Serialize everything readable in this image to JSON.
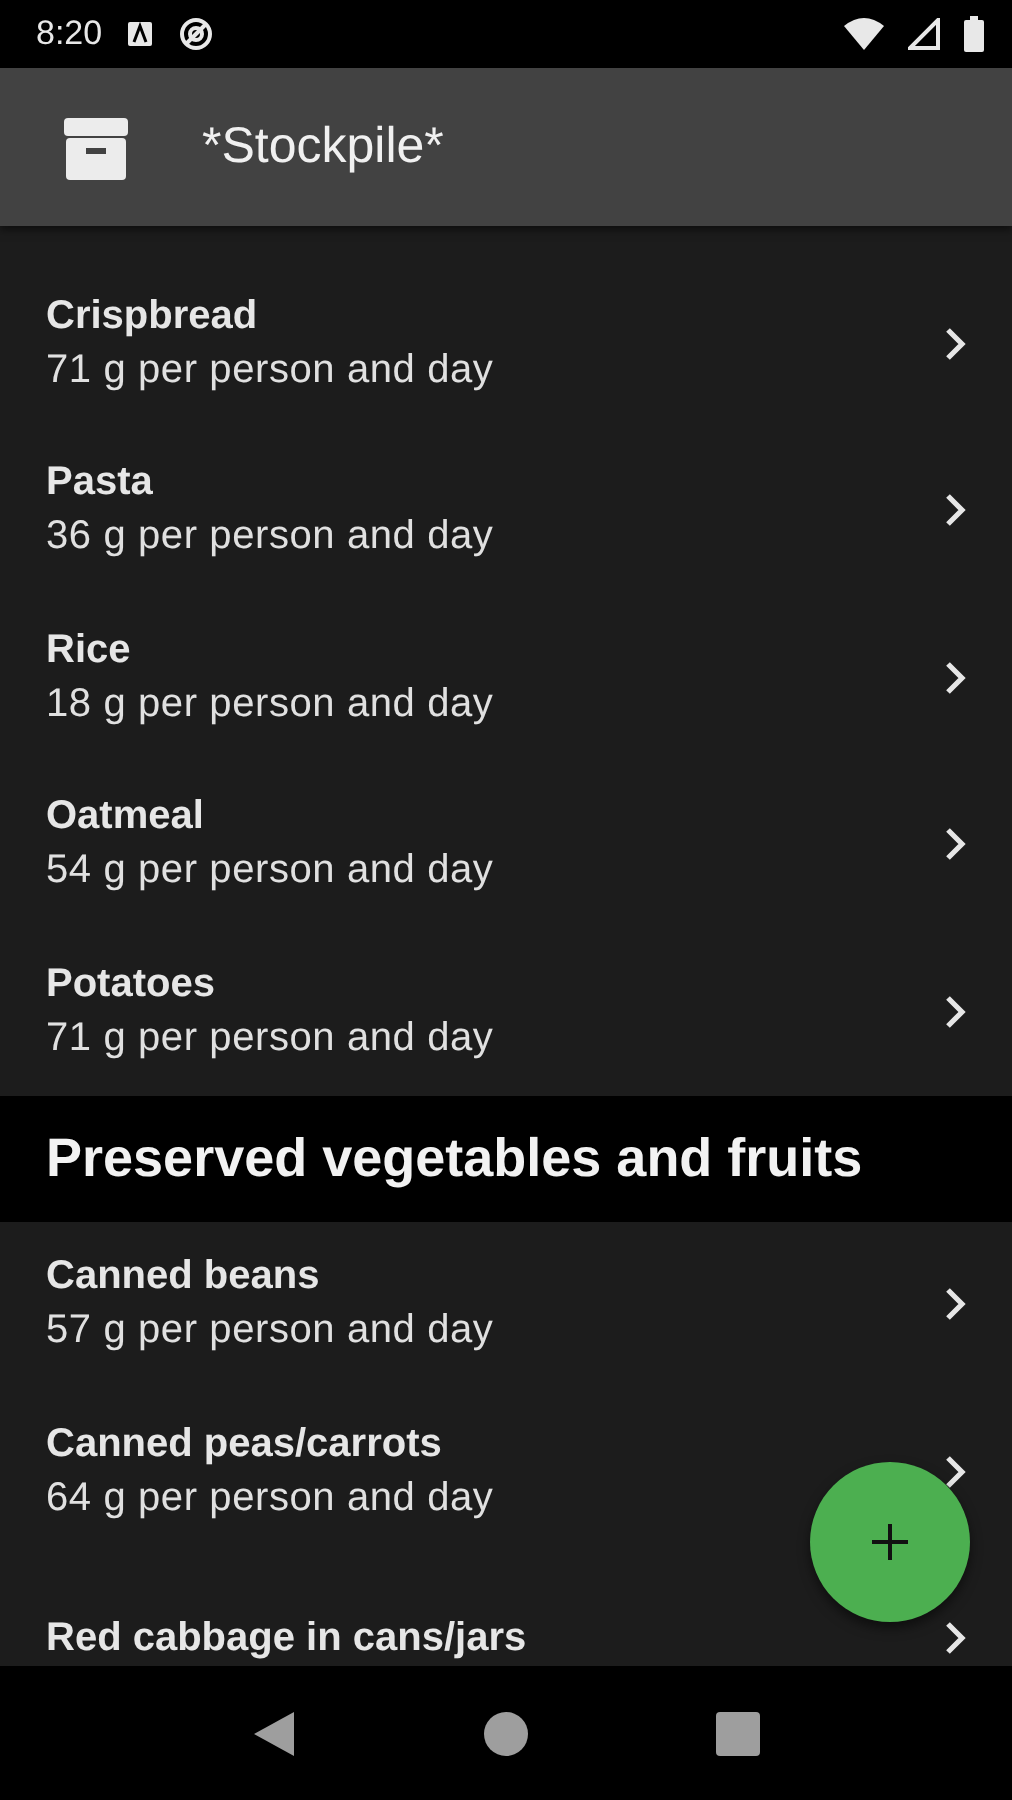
{
  "status_bar": {
    "time": "8:20"
  },
  "toolbar": {
    "title": "*Stockpile*"
  },
  "sections": [
    {
      "kind": "items",
      "items": [
        {
          "title": "Crispbread",
          "subtitle": "71 g per person and day"
        },
        {
          "title": "Pasta",
          "subtitle": "36 g per person and day"
        },
        {
          "title": "Rice",
          "subtitle": "18 g per person and day"
        },
        {
          "title": "Oatmeal",
          "subtitle": "54 g per person and day"
        },
        {
          "title": "Potatoes",
          "subtitle": "71 g per person and day"
        }
      ]
    },
    {
      "kind": "header",
      "title": "Preserved vegetables and fruits"
    },
    {
      "kind": "items",
      "items": [
        {
          "title": "Canned beans",
          "subtitle": "57 g per person and day"
        },
        {
          "title": "Canned peas/carrots",
          "subtitle": "64 g per person and day"
        },
        {
          "title": "Red cabbage in cans/jars"
        }
      ]
    }
  ]
}
